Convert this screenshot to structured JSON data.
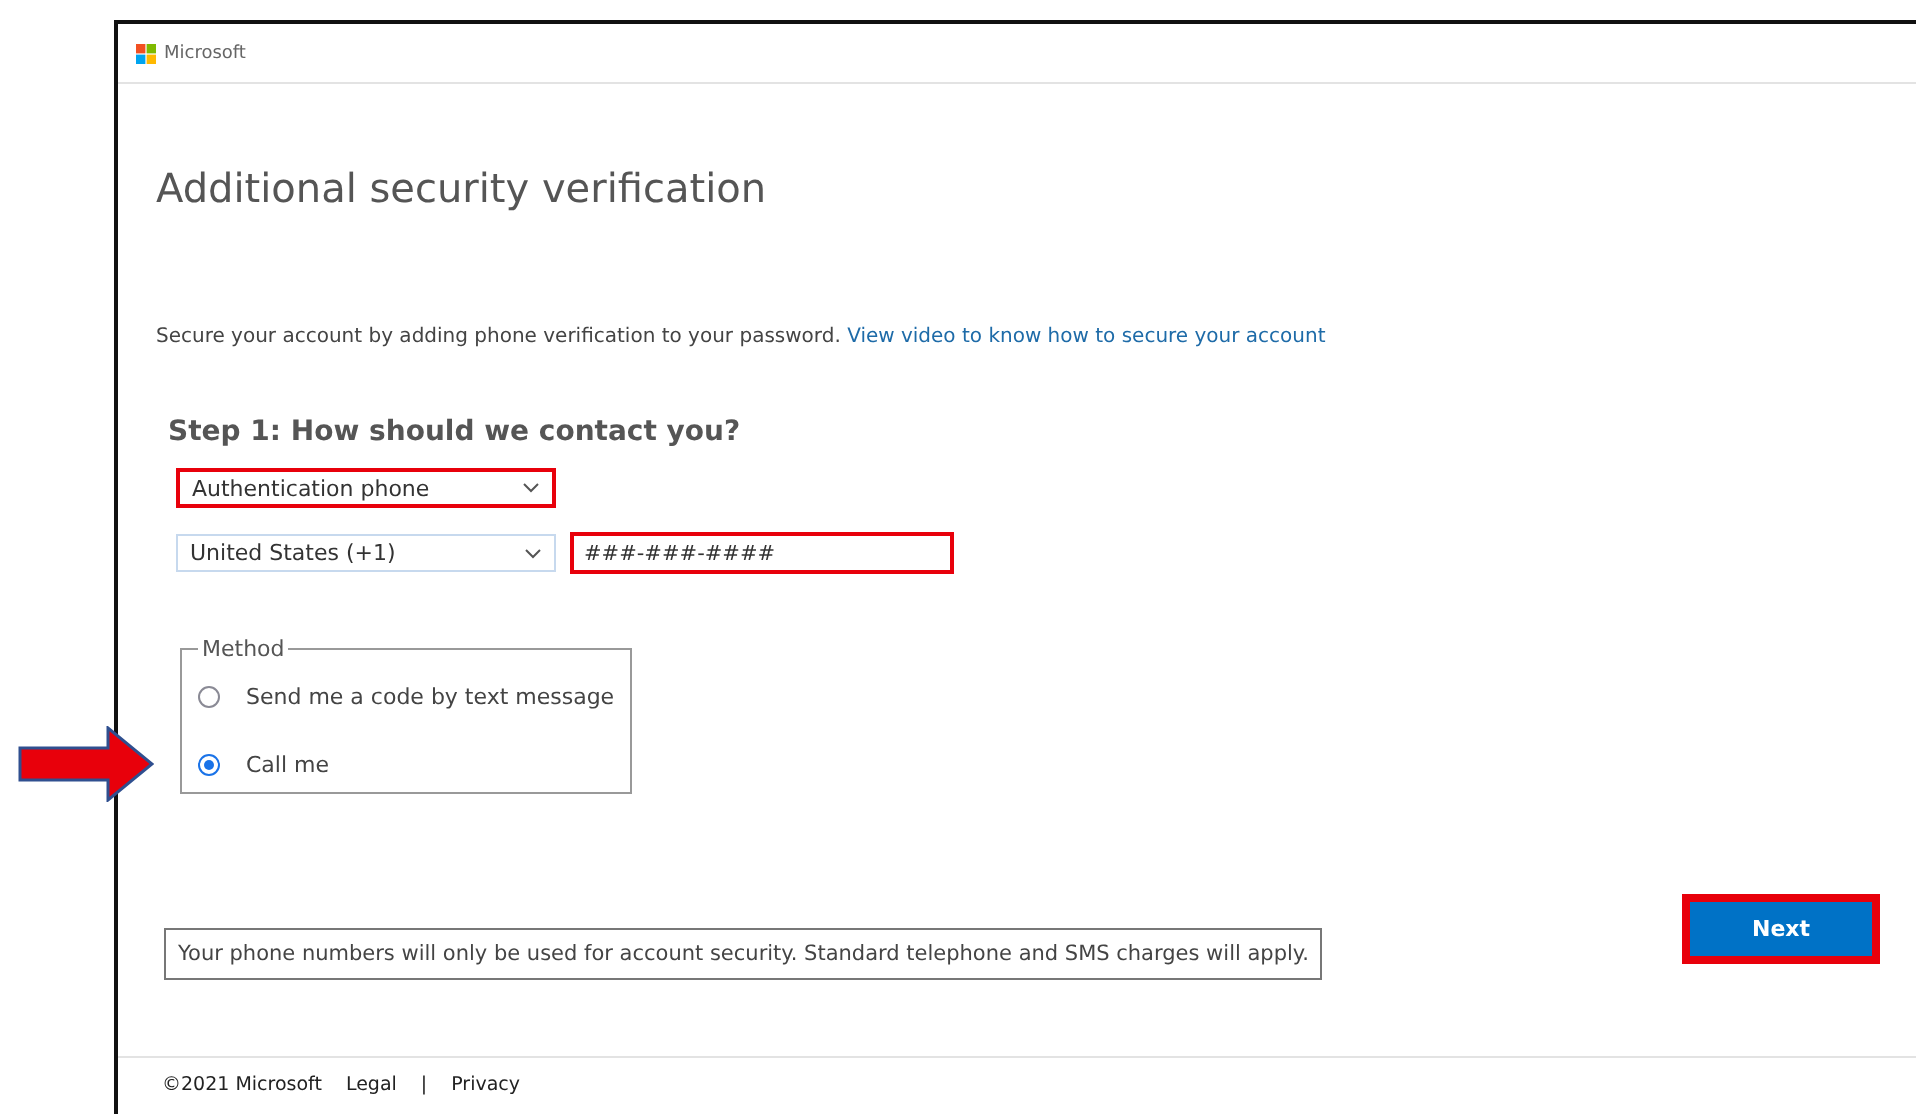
{
  "header": {
    "brand": "Microsoft"
  },
  "title": "Additional security verification",
  "intro": {
    "text": "Secure your account by adding phone verification to your password.",
    "link": "View video to know how to secure your account"
  },
  "step": {
    "heading": "Step 1: How should we contact you?",
    "contact_type": {
      "value": "Authentication phone",
      "highlighted": true
    },
    "country": {
      "value": "United States (+1)",
      "highlighted": false
    },
    "phone": {
      "value": "###-###-####",
      "highlighted": true
    },
    "method": {
      "legend": "Method",
      "options": [
        {
          "label": "Send me a code by text message",
          "selected": false,
          "annotated": false
        },
        {
          "label": "Call me",
          "selected": true,
          "annotated": true
        }
      ]
    }
  },
  "next_button": {
    "label": "Next",
    "highlighted": true
  },
  "notice": "Your phone numbers will only be used for account security. Standard telephone and SMS charges will apply.",
  "footer": {
    "copyright": "©2021 Microsoft",
    "links": [
      "Legal",
      "Privacy"
    ],
    "separator": "|"
  }
}
